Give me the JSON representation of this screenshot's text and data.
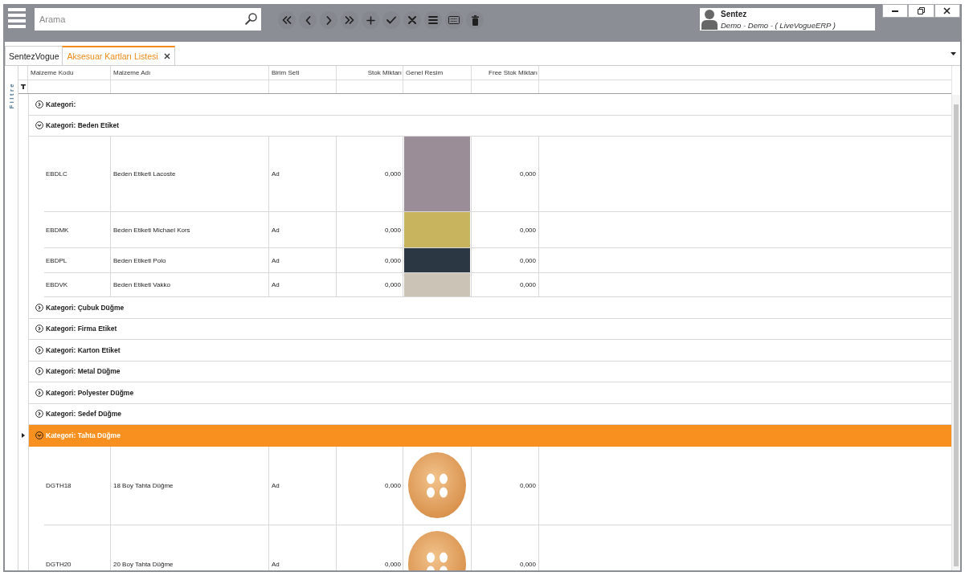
{
  "toolbar": {
    "search": {
      "placeholder": "Arama"
    },
    "buttons": [
      {
        "kind": "first"
      },
      {
        "kind": "previous"
      },
      {
        "kind": "next"
      },
      {
        "kind": "last"
      },
      {
        "kind": "add"
      },
      {
        "kind": "confirm"
      },
      {
        "kind": "cancel"
      },
      {
        "kind": "menu"
      },
      {
        "kind": "keyboard"
      },
      {
        "kind": "delete"
      }
    ],
    "user": {
      "name": "Sentez",
      "subtitle": "Demo - Demo - ( LiveVogueERP )"
    },
    "window_controls": [
      {
        "kind": "minimize"
      },
      {
        "kind": "restore"
      },
      {
        "kind": "close"
      }
    ]
  },
  "tabs": [
    {
      "label": "SentezVogue",
      "selected": false,
      "closable": false
    },
    {
      "label": "Aksesuar Kartları Listesi",
      "selected": true,
      "closable": true
    }
  ],
  "filter_panel": {
    "label": "Filtre"
  },
  "grid": {
    "columns": [
      {
        "label": "Malzeme Kodu",
        "kind": "text"
      },
      {
        "label": "Malzeme Adı",
        "kind": "text"
      },
      {
        "label": "Birim Seti",
        "kind": "text"
      },
      {
        "label": "Stok Miktarı",
        "kind": "number"
      },
      {
        "label": "Genel Resim",
        "kind": "image"
      },
      {
        "label": "Free Stok Miktarı",
        "kind": "number"
      }
    ],
    "groups": [
      {
        "label": "Kategori:",
        "expanded": false,
        "selected": false
      },
      {
        "label": "Kategori: Beden Etiket",
        "expanded": true,
        "selected": false,
        "rows": [
          {
            "code": "EBDLC",
            "name": "Beden Etiketi Lacoste",
            "unit": "Ad",
            "stock": "0,000",
            "image": {
              "kind": "label"
            },
            "free_stock": "0,000"
          },
          {
            "code": "EBDMK",
            "name": "Beden Etiketi Michael Kors",
            "unit": "Ad",
            "stock": "0,000",
            "image": {
              "kind": "label"
            },
            "free_stock": "0,000"
          },
          {
            "code": "EBDPL",
            "name": "Beden Etiketi Polo",
            "unit": "Ad",
            "stock": "0,000",
            "image": {
              "kind": "label"
            },
            "free_stock": "0,000"
          },
          {
            "code": "EBDVK",
            "name": "Beden Etiketi Vakko",
            "unit": "Ad",
            "stock": "0,000",
            "image": {
              "kind": "label"
            },
            "free_stock": "0,000"
          }
        ]
      },
      {
        "label": "Kategori: Çubuk Düğme",
        "expanded": false,
        "selected": false
      },
      {
        "label": "Kategori: Firma Etiket",
        "expanded": false,
        "selected": false
      },
      {
        "label": "Kategori: Karton Etiket",
        "expanded": false,
        "selected": false
      },
      {
        "label": "Kategori: Metal Düğme",
        "expanded": false,
        "selected": false
      },
      {
        "label": "Kategori: Polyester Düğme",
        "expanded": false,
        "selected": false
      },
      {
        "label": "Kategori: Sedef Düğme",
        "expanded": false,
        "selected": false
      },
      {
        "label": "Kategori: Tahta Düğme",
        "expanded": true,
        "selected": true,
        "rows": [
          {
            "code": "DGTH18",
            "name": "18 Boy Tahta Düğme",
            "unit": "Ad",
            "stock": "0,000",
            "image": {
              "kind": "button"
            },
            "free_stock": "0,000"
          },
          {
            "code": "DGTH20",
            "name": "20 Boy Tahta Düğme",
            "unit": "Ad",
            "stock": "0,000",
            "image": {
              "kind": "button"
            },
            "free_stock": "0,000"
          }
        ]
      }
    ]
  }
}
